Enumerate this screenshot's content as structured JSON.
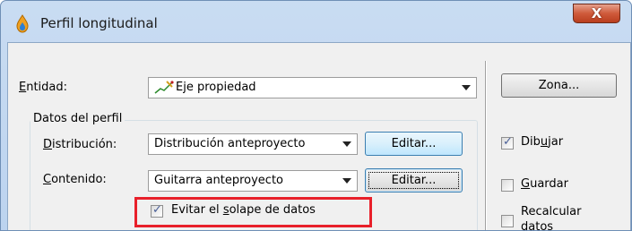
{
  "window": {
    "title": "Perfil longitudinal",
    "close_label": "X",
    "title_icon": "paint-drop-icon"
  },
  "entidad": {
    "label_prefix": "",
    "label_u": "E",
    "label_rest": "ntidad:",
    "selected": "Eje propiedad",
    "icon": "line-axis-icon"
  },
  "zona_button": "Zona...",
  "datos_perfil": {
    "group_title": "Datos del perfil",
    "distribucion": {
      "label_prefix": "",
      "label_u": "D",
      "label_rest": "istribución:",
      "selected": "Distribución anteproyecto",
      "edit_label": "Editar..."
    },
    "contenido": {
      "label_prefix": "",
      "label_u": "C",
      "label_rest": "ontenido:",
      "selected": "Guitarra anteproyecto",
      "edit_label": "Editar..."
    },
    "evitar_solape": {
      "label_prefix": "Evitar el ",
      "label_u": "s",
      "label_rest": "olape de datos",
      "checked": true
    }
  },
  "options": {
    "dibujar": {
      "label_prefix": "Dib",
      "label_u": "u",
      "label_rest": "jar",
      "checked": true
    },
    "guardar": {
      "label_prefix": "",
      "label_u": "G",
      "label_rest": "uardar",
      "checked": false
    },
    "recalcular": {
      "label_line1": "Recalcular",
      "label_line2": "datos",
      "checked": false
    }
  },
  "colors": {
    "highlight": "#e8202a",
    "check_mark": "#4a5f97"
  }
}
